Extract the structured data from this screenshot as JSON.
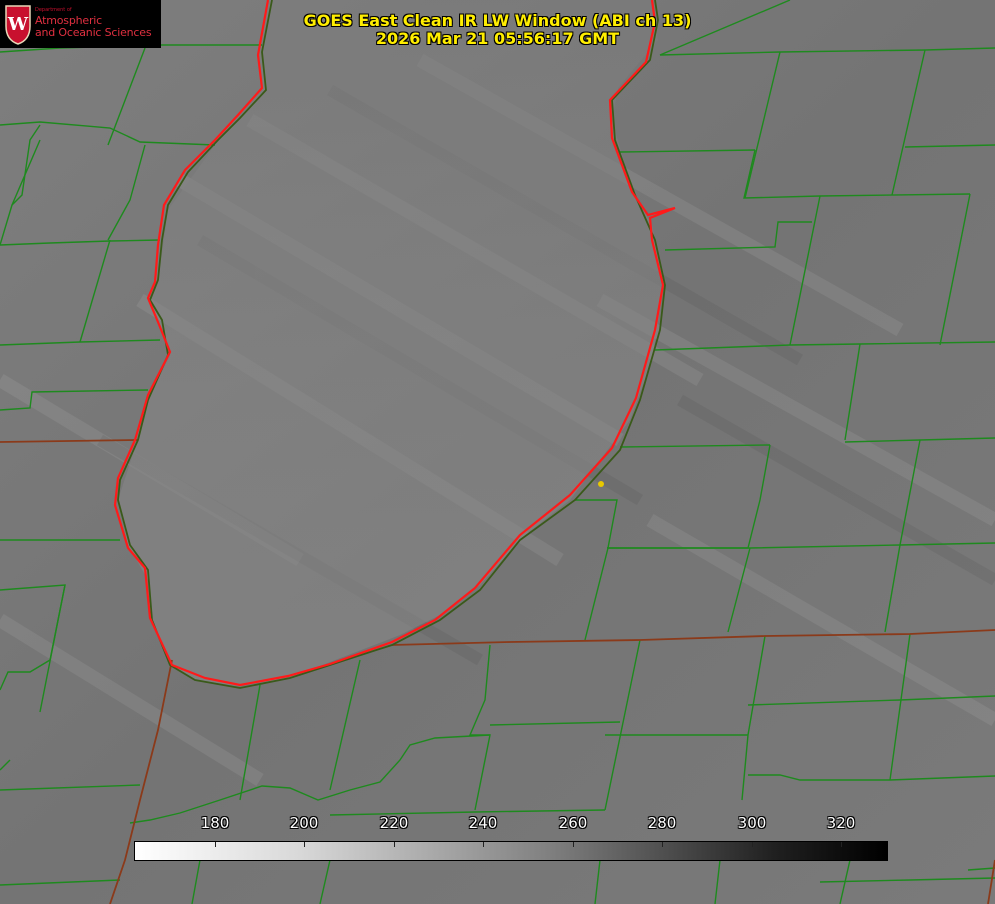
{
  "title": {
    "line1": "GOES East Clean IR LW Window (ABI ch 13)",
    "line2": "2026 Mar 21 05:56:17 GMT"
  },
  "logo": {
    "department": "Department of",
    "line1": "Atmospheric",
    "line2": "and Oceanic Sciences"
  },
  "colorbar": {
    "ticks": [
      "180",
      "200",
      "220",
      "240",
      "260",
      "280",
      "300",
      "320"
    ]
  },
  "colors": {
    "title": "#ffee00",
    "county_lines": "#1e8a1e",
    "state_lines": "#8b3a1a",
    "lake_outline": "#ff1a1a",
    "marker": "#e8c800"
  }
}
